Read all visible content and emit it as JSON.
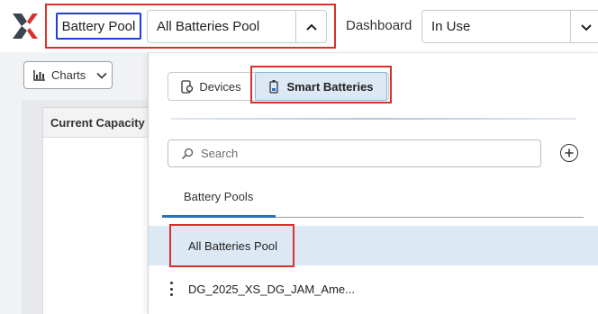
{
  "header": {
    "pool_label": "Battery Pool",
    "pool_select_value": "All Batteries Pool",
    "dashboard_label": "Dashboard",
    "dashboard_select_value": "In Use"
  },
  "toolbar": {
    "charts_label": "Charts"
  },
  "background": {
    "card_header": "Current Capacity"
  },
  "dropdown": {
    "segment": {
      "devices_label": "Devices",
      "smart_batteries_label": "Smart Batteries",
      "selected": "Smart Batteries"
    },
    "search": {
      "placeholder": "Search"
    },
    "tabs": [
      {
        "label": "Battery Pools",
        "active": true
      }
    ],
    "list": [
      {
        "label": "All Batteries Pool",
        "selected": true
      },
      {
        "label": "DG_2025_XS_DG_JAM_Ame..."
      }
    ]
  },
  "colors": {
    "highlight_red": "#d9302b",
    "highlight_blue": "#1f3fd1",
    "selected_bg": "#dde8f5",
    "tab_accent": "#2e6fba",
    "logo_dark": "#3b4451",
    "logo_red": "#d9302b"
  },
  "icons": {
    "logo": "brand-x-logo",
    "pool_chevron": "chevron-up-icon",
    "dashboard_chevron": "chevron-down-icon",
    "charts": "bar-chart-icon",
    "charts_chevron": "chevron-down-icon",
    "devices": "device-icon",
    "smart_batteries": "battery-icon",
    "search": "search-icon",
    "add": "plus-circle-icon",
    "row_menu": "kebab-menu-icon"
  }
}
